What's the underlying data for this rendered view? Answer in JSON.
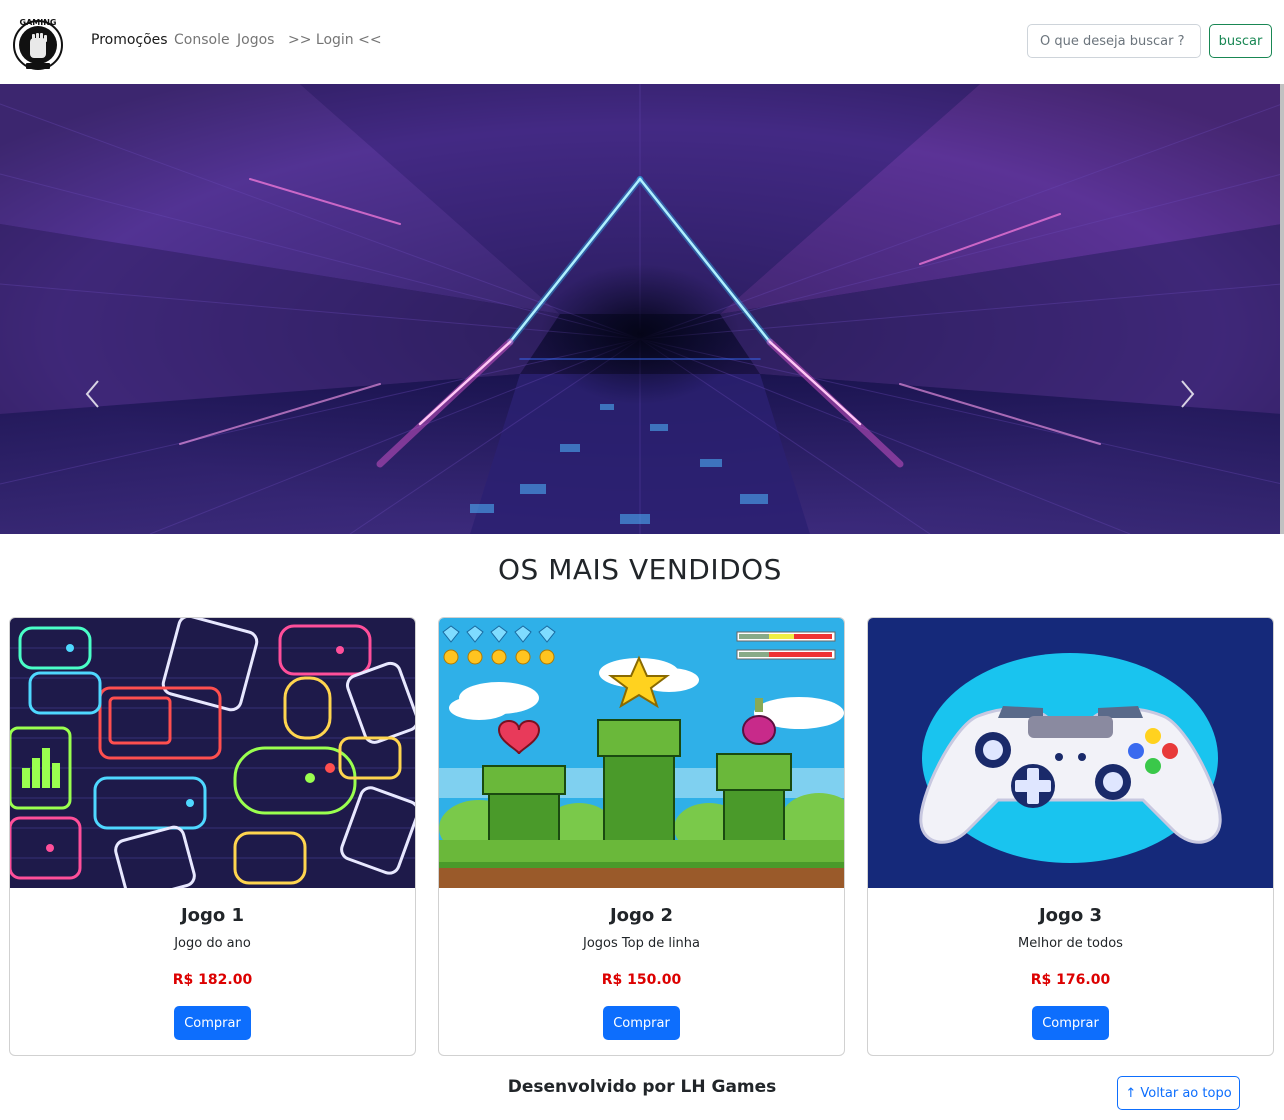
{
  "navbar": {
    "logo_text": "GAMING",
    "links": [
      {
        "label": "Promoções",
        "active": true
      },
      {
        "label": "Console",
        "active": false
      },
      {
        "label": "Jogos",
        "active": false
      },
      {
        "label": ">> Login <<",
        "active": false
      }
    ],
    "search": {
      "placeholder": "O que deseja buscar ?",
      "button_label": "buscar"
    }
  },
  "carousel": {
    "prev_icon": "chevron-left-icon",
    "next_icon": "chevron-right-icon"
  },
  "section": {
    "title": "OS MAIS VENDIDOS"
  },
  "products": [
    {
      "title": "Jogo 1",
      "description": "Jogo do ano",
      "price": "R$ 182.00",
      "button_label": "Comprar"
    },
    {
      "title": "Jogo 2",
      "description": "Jogos Top de linha",
      "price": "R$ 150.00",
      "button_label": "Comprar"
    },
    {
      "title": "Jogo 3",
      "description": "Melhor de todos",
      "price": "R$ 176.00",
      "button_label": "Comprar"
    }
  ],
  "footer": {
    "text": "Desenvolvido por LH Games",
    "back_to_top_label": "↑ Voltar ao topo"
  },
  "colors": {
    "primary": "#0d6efd",
    "success": "#198754",
    "price": "#dc0000"
  }
}
